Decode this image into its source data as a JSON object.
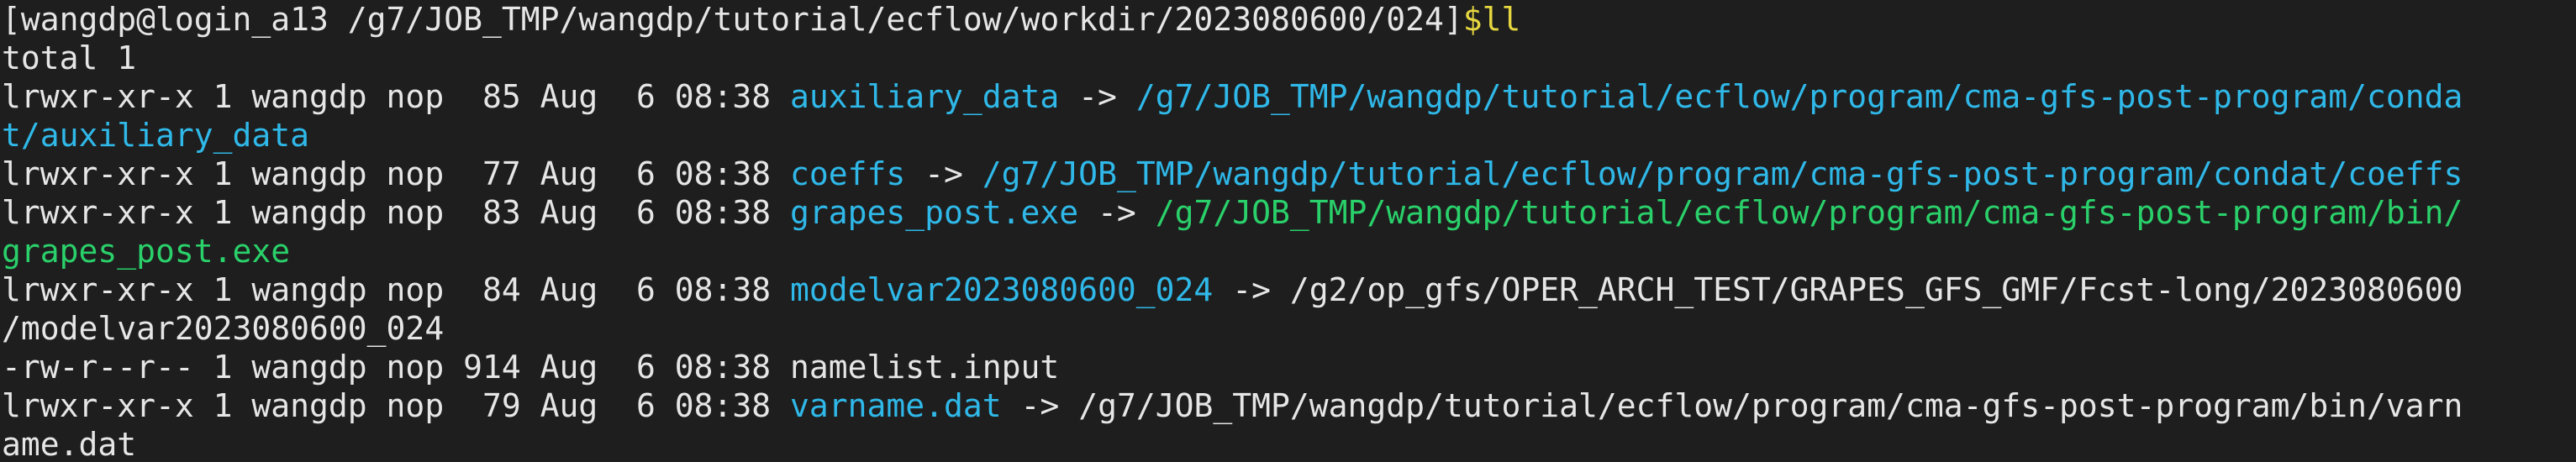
{
  "terminal": {
    "prompt": "[wangdp@login_a13 /g7/JOB_TMP/wangdp/tutorial/ecflow/workdir/2023080600/024]",
    "command": "$ll",
    "total": "total 1",
    "entries": [
      {
        "perms": "lrwxr-xr-x 1 wangdp nop  85 Aug  6 08:38 ",
        "name": "auxiliary_data",
        "arrow": " -> ",
        "target_line1": "/g7/JOB_TMP/wangdp/tutorial/ecflow/program/cma-gfs-post-program/conda",
        "target_line2": "t/auxiliary_data"
      },
      {
        "perms": "lrwxr-xr-x 1 wangdp nop  77 Aug  6 08:38 ",
        "name": "coeffs",
        "arrow": " -> ",
        "target_line1": "/g7/JOB_TMP/wangdp/tutorial/ecflow/program/cma-gfs-post-program/condat/coeffs"
      },
      {
        "perms": "lrwxr-xr-x 1 wangdp nop  83 Aug  6 08:38 ",
        "name": "grapes_post.exe",
        "arrow": " -> ",
        "target_line1": "/g7/JOB_TMP/wangdp/tutorial/ecflow/program/cma-gfs-post-program/bin/",
        "target_line2": "grapes_post.exe"
      },
      {
        "perms": "lrwxr-xr-x 1 wangdp nop  84 Aug  6 08:38 ",
        "name": "modelvar2023080600_024",
        "arrow": " -> ",
        "target_line1": "/g2/op_gfs/OPER_ARCH_TEST/GRAPES_GFS_GMF/Fcst-long/2023080600",
        "target_line2": "/modelvar2023080600_024"
      },
      {
        "perms": "-rw-r--r-- 1 wangdp nop 914 Aug  6 08:38 ",
        "name": "namelist.input"
      },
      {
        "perms": "lrwxr-xr-x 1 wangdp nop  79 Aug  6 08:38 ",
        "name": "varname.dat",
        "arrow": " -> ",
        "target_line1": "/g7/JOB_TMP/wangdp/tutorial/ecflow/program/cma-gfs-post-program/bin/varn",
        "target_line2": "ame.dat"
      }
    ]
  },
  "colors": {
    "background": "#1e1e1e",
    "text": "#e6e6e6",
    "command": "#e6d740",
    "symlink": "#2fb8e8",
    "executable": "#2ad06a"
  }
}
